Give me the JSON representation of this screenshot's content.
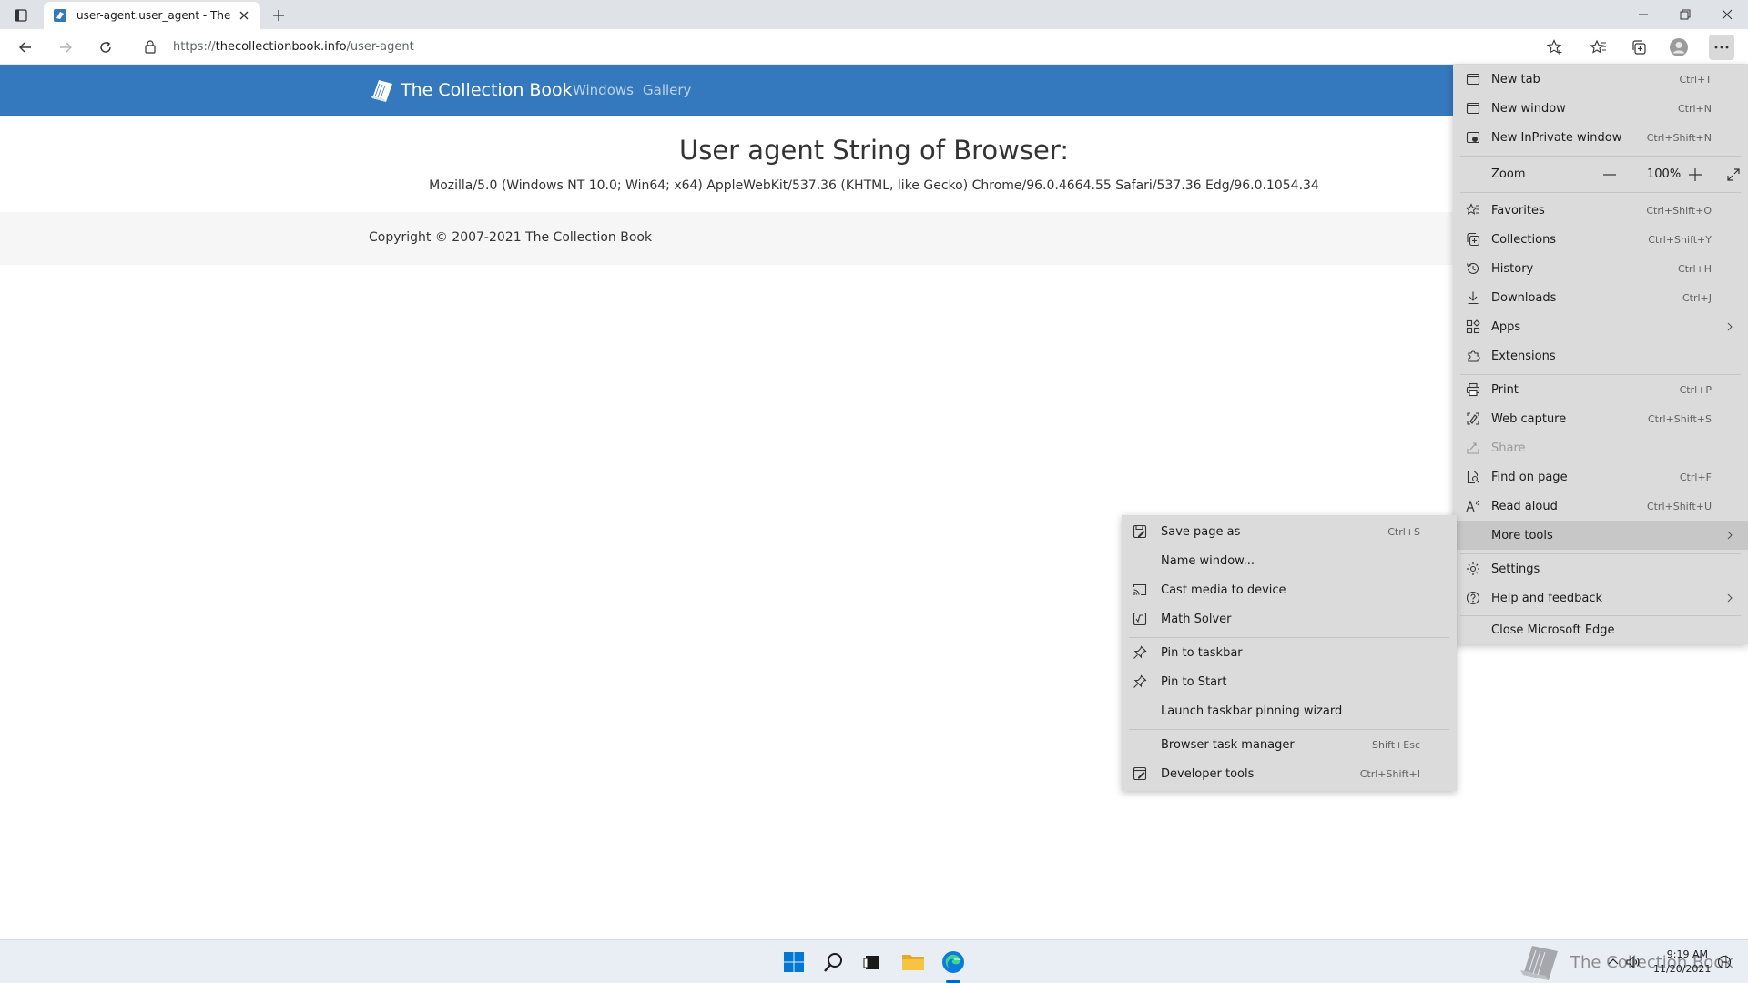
{
  "browser": {
    "tab": {
      "title": "user-agent.user_agent - The Coll"
    },
    "address": {
      "url_prefix": "https://",
      "url_host": "thecollectionbook.info",
      "url_path": "/user-agent"
    }
  },
  "site": {
    "brand": "The Collection Book",
    "nav": [
      "Windows",
      "Gallery"
    ],
    "heading": "User agent String of Browser:",
    "user_agent": "Mozilla/5.0 (Windows NT 10.0; Win64; x64) AppleWebKit/537.36 (KHTML, like Gecko) Chrome/96.0.4664.55 Safari/537.36 Edg/96.0.1054.34",
    "copyright": "Copyright © 2007-2021 The Collection Book"
  },
  "menu": {
    "new_tab": {
      "label": "New tab",
      "shortcut": "Ctrl+T"
    },
    "new_window": {
      "label": "New window",
      "shortcut": "Ctrl+N"
    },
    "new_inprivate": {
      "label": "New InPrivate window",
      "shortcut": "Ctrl+Shift+N"
    },
    "zoom": {
      "label": "Zoom",
      "value": "100%"
    },
    "favorites": {
      "label": "Favorites",
      "shortcut": "Ctrl+Shift+O"
    },
    "collections": {
      "label": "Collections",
      "shortcut": "Ctrl+Shift+Y"
    },
    "history": {
      "label": "History",
      "shortcut": "Ctrl+H"
    },
    "downloads": {
      "label": "Downloads",
      "shortcut": "Ctrl+J"
    },
    "apps": {
      "label": "Apps"
    },
    "extensions": {
      "label": "Extensions"
    },
    "print": {
      "label": "Print",
      "shortcut": "Ctrl+P"
    },
    "web_capture": {
      "label": "Web capture",
      "shortcut": "Ctrl+Shift+S"
    },
    "share": {
      "label": "Share"
    },
    "find_on_page": {
      "label": "Find on page",
      "shortcut": "Ctrl+F"
    },
    "read_aloud": {
      "label": "Read aloud",
      "shortcut": "Ctrl+Shift+U"
    },
    "more_tools": {
      "label": "More tools"
    },
    "settings": {
      "label": "Settings"
    },
    "help": {
      "label": "Help and feedback"
    },
    "close_edge": {
      "label": "Close Microsoft Edge"
    }
  },
  "submenu": {
    "save_page": {
      "label": "Save page as",
      "shortcut": "Ctrl+S"
    },
    "name_window": {
      "label": "Name window..."
    },
    "cast_media": {
      "label": "Cast media to device"
    },
    "math_solver": {
      "label": "Math Solver"
    },
    "pin_taskbar": {
      "label": "Pin to taskbar"
    },
    "pin_start": {
      "label": "Pin to Start"
    },
    "pin_wizard": {
      "label": "Launch taskbar pinning wizard"
    },
    "task_manager": {
      "label": "Browser task manager",
      "shortcut": "Shift+Esc"
    },
    "dev_tools": {
      "label": "Developer tools",
      "shortcut": "Ctrl+Shift+I"
    }
  },
  "taskbar": {
    "watermark": "The Collection Book",
    "time": "9:19 AM",
    "date": "11/20/2021"
  },
  "colors": {
    "site_nav": "#3479bd",
    "menu_bg": "#dbdbdb",
    "menu_highlight": "#c7c7c7",
    "accent": "#0067c0"
  }
}
